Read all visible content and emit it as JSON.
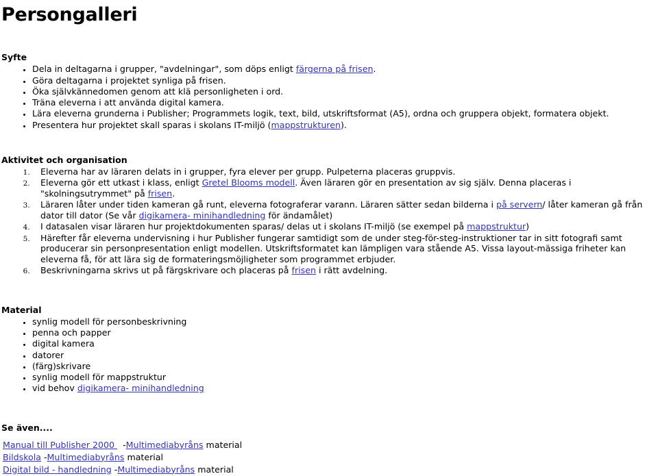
{
  "document": {
    "title": "Persongalleri",
    "link_color": "#3333b0",
    "text_color": "#000000",
    "background_color": "#ffffff"
  },
  "syfte": {
    "heading": "Syfte",
    "items": [
      {
        "pre": "Dela in deltagarna i grupper, \"avdelningar\", som döps enligt ",
        "link": "färgerna på frisen",
        "post": "."
      },
      {
        "pre": "Göra deltagarna i projektet synliga på frisen.",
        "link": "",
        "post": ""
      },
      {
        "pre": "Öka självkännedomen genom att klä personligheten i ord.",
        "link": "",
        "post": ""
      },
      {
        "pre": "Träna eleverna i att använda digital kamera.",
        "link": "",
        "post": ""
      },
      {
        "pre": "Lära eleverna grunderna i Publisher; Programmets logik, text, bild, utskriftsformat (A5), ordna och gruppera objekt, formatera objekt.",
        "link": "",
        "post": ""
      },
      {
        "pre": "Presentera hur projektet skall sparas i skolans IT-miljö (",
        "link": "mappstrukturen",
        "post": ")."
      }
    ]
  },
  "aktivitet": {
    "heading": "Aktivitet och organisation",
    "items": [
      {
        "p1": "Eleverna har av läraren delats in i grupper, fyra elever per grupp. Pulpeterna placeras gruppvis.",
        "l1": "",
        "p2": "",
        "l2": "",
        "p3": ""
      },
      {
        "p1": "Eleverna gör ett utkast i klass, enligt ",
        "l1": "Gretel Blooms modell",
        "p2": ". Även läraren gör en presentation av sig själv. Denna placeras i \"skolningsutrymmet\" på ",
        "l2": "frisen",
        "p3": "."
      },
      {
        "p1": "Läraren låter under tiden kameran gå runt, eleverna fotograferar varann. Läraren sätter sedan bilderna i ",
        "l1": "på servern",
        "p2": "/ låter kameran gå från dator till dator (Se vår ",
        "l2": "digikamera- minihandledning",
        "p3": " för ändamålet)"
      },
      {
        "p1": "I datasalen visar läraren hur projektdokumenten sparas/ delas ut i skolans IT-miljö (se exempel på ",
        "l1": "mappstruktur",
        "p2": ")",
        "l2": "",
        "p3": ""
      },
      {
        "p1": "Härefter får eleverna undervisning i hur Publisher fungerar samtidigt som de under steg-för-steg-instruktioner tar in sitt fotografi samt producerar sin personpresentation enligt modellen. Utskriftsformatet kan lämpligen vara stående A5. Vissa layout-mässiga friheter kan eleverna få, för att lära sig de formateringsmöjligheter som programmet erbjuder.",
        "l1": "",
        "p2": "",
        "l2": "",
        "p3": ""
      },
      {
        "p1": "Beskrivningarna skrivs ut på färgskrivare och placeras på ",
        "l1": "frisen",
        "p2": " i rätt avdelning.",
        "l2": "",
        "p3": ""
      }
    ]
  },
  "material": {
    "heading": "Material",
    "items": [
      {
        "pre": "synlig modell för personbeskrivning",
        "link": "",
        "post": ""
      },
      {
        "pre": "penna och papper",
        "link": "",
        "post": ""
      },
      {
        "pre": "digital kamera",
        "link": "",
        "post": ""
      },
      {
        "pre": "datorer",
        "link": "",
        "post": ""
      },
      {
        "pre": "(färg)skrivare",
        "link": "",
        "post": ""
      },
      {
        "pre": "synlig modell för mappstruktur",
        "link": "",
        "post": ""
      },
      {
        "pre": "vid behov ",
        "link": "digikamera- minihandledning",
        "post": ""
      }
    ]
  },
  "se_aven": {
    "heading": "Se även....",
    "lines": [
      {
        "l1": "Manual till Publisher 2000 ",
        "mid": "  -",
        "l2": "Multimediabyråns",
        "post": " material"
      },
      {
        "l1": "Bildskola",
        "mid": " -",
        "l2": "Multimediabyråns",
        "post": " material"
      },
      {
        "l1": "Digital bild - handledning",
        "mid": " -",
        "l2": "Multimediabyråns",
        "post": " material"
      }
    ]
  }
}
